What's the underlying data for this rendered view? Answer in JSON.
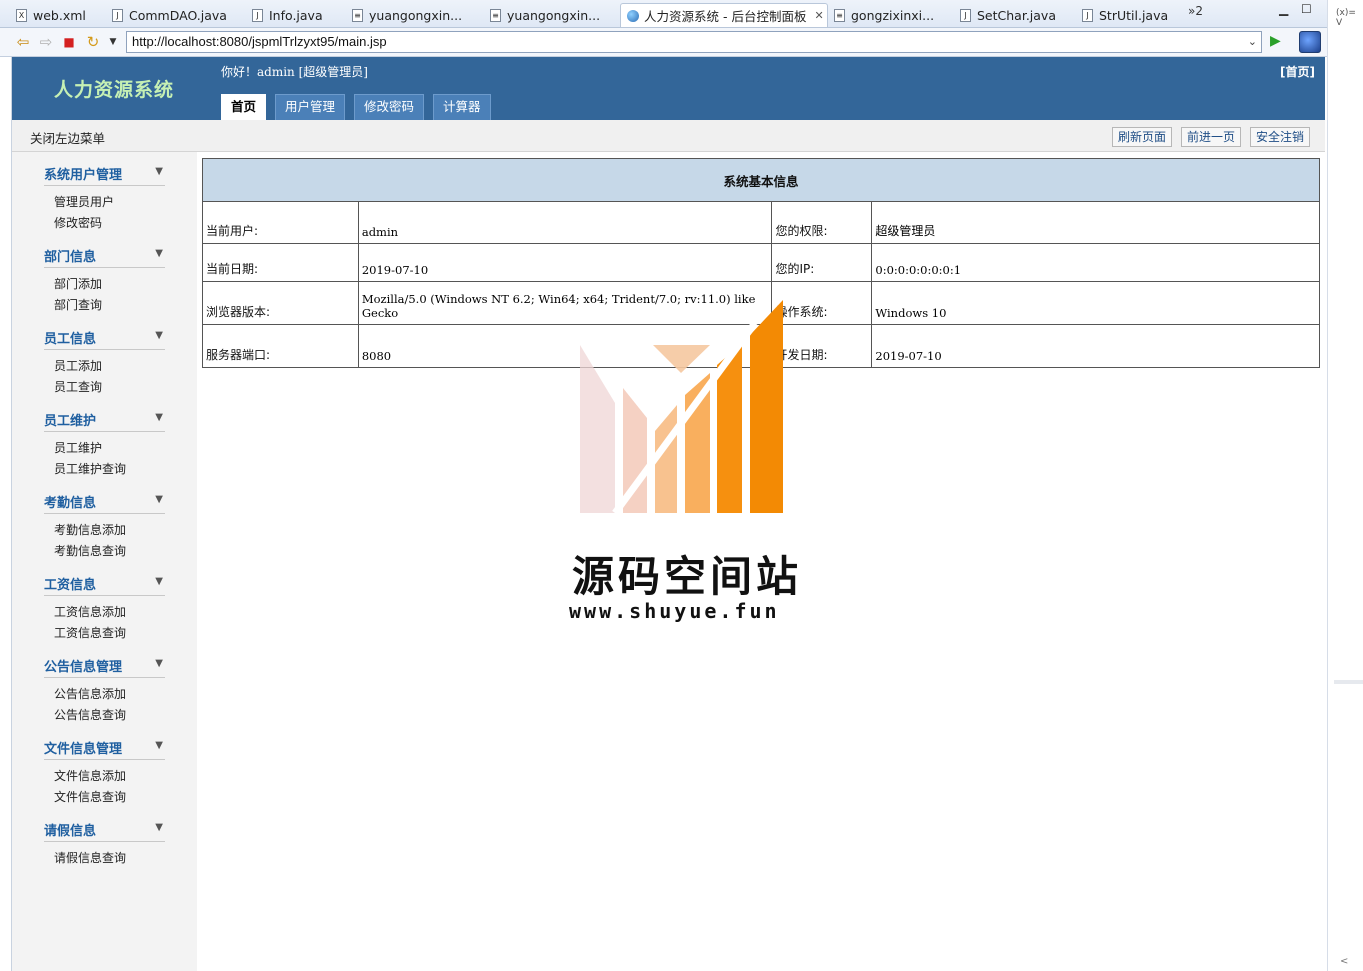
{
  "ide": {
    "tabs": [
      {
        "label": "web.xml",
        "icon": "x"
      },
      {
        "label": "CommDAO.java",
        "icon": "J"
      },
      {
        "label": "Info.java",
        "icon": "J"
      },
      {
        "label": "yuangongxin...",
        "icon": "doc"
      },
      {
        "label": "yuangongxin...",
        "icon": "doc"
      },
      {
        "label": "人力资源系统 - 后台控制面板",
        "icon": "globe"
      },
      {
        "label": "gongzixinxi...",
        "icon": "doc"
      },
      {
        "label": "SetChar.java",
        "icon": "J"
      },
      {
        "label": "StrUtil.java",
        "icon": "J"
      }
    ],
    "more_tabs": "»2",
    "variables_label": "(x)= V"
  },
  "browser": {
    "url": "http://localhost:8080/jspmlTrlzyxt95/main.jsp"
  },
  "header": {
    "brand": "人力资源系统",
    "welcome": "你好！admin [超级管理员]",
    "home": "[首页]",
    "tabs": [
      "首页",
      "用户管理",
      "修改密码",
      "计算器"
    ],
    "bg_color": "#336699"
  },
  "subbar": {
    "toggle": "关闭左边菜单",
    "refresh": "刷新页面",
    "forward": "前进一页",
    "logout": "安全注销"
  },
  "sidebar": {
    "groups": [
      {
        "title": "系统用户管理",
        "items": [
          "管理员用户",
          "修改密码"
        ]
      },
      {
        "title": "部门信息",
        "items": [
          "部门添加",
          "部门查询"
        ]
      },
      {
        "title": "员工信息",
        "items": [
          "员工添加",
          "员工查询"
        ]
      },
      {
        "title": "员工维护",
        "items": [
          "员工维护",
          "员工维护查询"
        ]
      },
      {
        "title": "考勤信息",
        "items": [
          "考勤信息添加",
          "考勤信息查询"
        ]
      },
      {
        "title": "工资信息",
        "items": [
          "工资信息添加",
          "工资信息查询"
        ]
      },
      {
        "title": "公告信息管理",
        "items": [
          "公告信息添加",
          "公告信息查询"
        ]
      },
      {
        "title": "文件信息管理",
        "items": [
          "文件信息添加",
          "文件信息查询"
        ]
      },
      {
        "title": "请假信息",
        "items": [
          "请假信息查询"
        ]
      }
    ]
  },
  "info": {
    "title": "系统基本信息",
    "rows": [
      {
        "l1": "当前用户:",
        "v1": "admin",
        "l2": "您的权限:",
        "v2": "超级管理员"
      },
      {
        "l1": "当前日期:",
        "v1": "2019-07-10",
        "l2": "您的IP:",
        "v2": "0:0:0:0:0:0:0:1"
      },
      {
        "l1": "浏览器版本:",
        "v1": "Mozilla/5.0 (Windows NT 6.2; Win64; x64; Trident/7.0; rv:11.0) like Gecko",
        "l2": "操作系统:",
        "v2": "Windows 10"
      },
      {
        "l1": "服务器端口:",
        "v1": "8080",
        "l2": "开发日期:",
        "v2": "2019-07-10"
      }
    ]
  },
  "watermark": {
    "title": "源码空间站",
    "url": "www.shuyue.fun"
  }
}
